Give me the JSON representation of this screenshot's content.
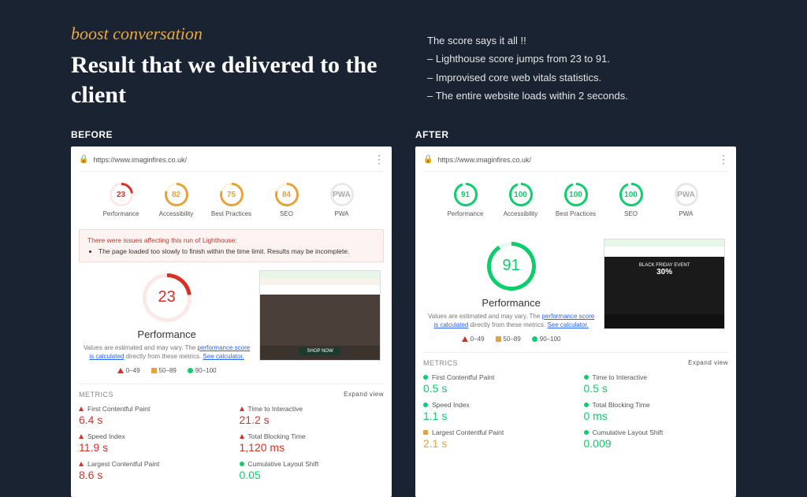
{
  "eyebrow": "boost conversation",
  "headline": "Result that we delivered to the client",
  "summary": {
    "line1": "The score says it all !!",
    "line2": "– Lighthouse score jumps from 23 to 91.",
    "line3": "– Improvised core web vitals statistics.",
    "line4": "– The entire website loads within 2 seconds."
  },
  "before": {
    "label": "BEFORE",
    "url": "https://www.imaginfires.co.uk/",
    "gauges": [
      {
        "score": "23",
        "label": "Performance",
        "cls": "g-red"
      },
      {
        "score": "82",
        "label": "Accessibility",
        "cls": "g-orange"
      },
      {
        "score": "75",
        "label": "Best Practices",
        "cls": "g-orange"
      },
      {
        "score": "84",
        "label": "SEO",
        "cls": "g-orange"
      },
      {
        "score": "PWA",
        "label": "PWA",
        "cls": "g-grey"
      }
    ],
    "warning_title": "There were issues affecting this run of Lighthouse:",
    "warning_item": "The page loaded too slowly to finish within the time limit. Results may be incomplete.",
    "big_score": "23",
    "perf_title": "Performance",
    "perf_desc_a": "Values are estimated and may vary. The ",
    "perf_link1": "performance score is calculated",
    "perf_desc_b": " directly from these metrics. ",
    "perf_link2": "See calculator.",
    "legend": {
      "r": "0–49",
      "o": "50–89",
      "g": "90–100"
    },
    "metrics_label": "METRICS",
    "expand": "Expand view",
    "metrics": [
      {
        "name": "First Contentful Paint",
        "value": "6.4 s",
        "shape": "tri",
        "vcls": "mv-red"
      },
      {
        "name": "Time to Interactive",
        "value": "21.2 s",
        "shape": "tri",
        "vcls": "mv-red"
      },
      {
        "name": "Speed Index",
        "value": "11.9 s",
        "shape": "tri",
        "vcls": "mv-red"
      },
      {
        "name": "Total Blocking Time",
        "value": "1,120 ms",
        "shape": "tri",
        "vcls": "mv-red"
      },
      {
        "name": "Largest Contentful Paint",
        "value": "8.6 s",
        "shape": "tri",
        "vcls": "mv-red"
      },
      {
        "name": "Cumulative Layout Shift",
        "value": "0.05",
        "shape": "dot",
        "vcls": "mv-green"
      }
    ]
  },
  "after": {
    "label": "AFTER",
    "url": "https://www.imaginfires.co.uk/",
    "gauges": [
      {
        "score": "91",
        "label": "Performance",
        "cls": "g-green"
      },
      {
        "score": "100",
        "label": "Accessibility",
        "cls": "g-green"
      },
      {
        "score": "100",
        "label": "Best Practices",
        "cls": "g-green"
      },
      {
        "score": "100",
        "label": "SEO",
        "cls": "g-green"
      },
      {
        "score": "PWA",
        "label": "PWA",
        "cls": "g-grey"
      }
    ],
    "big_score": "91",
    "perf_title": "Performance",
    "perf_desc_a": "Values are estimated and may vary. The ",
    "perf_link1": "performance score is calculated",
    "perf_desc_b": " directly from these metrics. ",
    "perf_link2": "See calculator.",
    "legend": {
      "r": "0–49",
      "o": "50–89",
      "g": "90–100"
    },
    "metrics_label": "METRICS",
    "expand": "Expand view",
    "metrics": [
      {
        "name": "First Contentful Paint",
        "value": "0.5 s",
        "shape": "dot",
        "vcls": "mv-green"
      },
      {
        "name": "Time to Interactive",
        "value": "0.5 s",
        "shape": "dot",
        "vcls": "mv-green"
      },
      {
        "name": "Speed Index",
        "value": "1.1 s",
        "shape": "dot",
        "vcls": "mv-green"
      },
      {
        "name": "Total Blocking Time",
        "value": "0 ms",
        "shape": "dot",
        "vcls": "mv-green"
      },
      {
        "name": "Largest Contentful Paint",
        "value": "2.1 s",
        "shape": "sq",
        "vcls": "mv-orange"
      },
      {
        "name": "Cumulative Layout Shift",
        "value": "0.009",
        "shape": "dot",
        "vcls": "mv-green"
      }
    ]
  },
  "chart_data": {
    "type": "table",
    "title": "Lighthouse audit comparison",
    "series": [
      {
        "name": "Before",
        "scores": {
          "Performance": 23,
          "Accessibility": 82,
          "Best Practices": 75,
          "SEO": 84
        },
        "metrics": {
          "First Contentful Paint": "6.4 s",
          "Time to Interactive": "21.2 s",
          "Speed Index": "11.9 s",
          "Total Blocking Time": "1,120 ms",
          "Largest Contentful Paint": "8.6 s",
          "Cumulative Layout Shift": 0.05
        }
      },
      {
        "name": "After",
        "scores": {
          "Performance": 91,
          "Accessibility": 100,
          "Best Practices": 100,
          "SEO": 100
        },
        "metrics": {
          "First Contentful Paint": "0.5 s",
          "Time to Interactive": "0.5 s",
          "Speed Index": "1.1 s",
          "Total Blocking Time": "0 ms",
          "Largest Contentful Paint": "2.1 s",
          "Cumulative Layout Shift": 0.009
        }
      }
    ]
  }
}
